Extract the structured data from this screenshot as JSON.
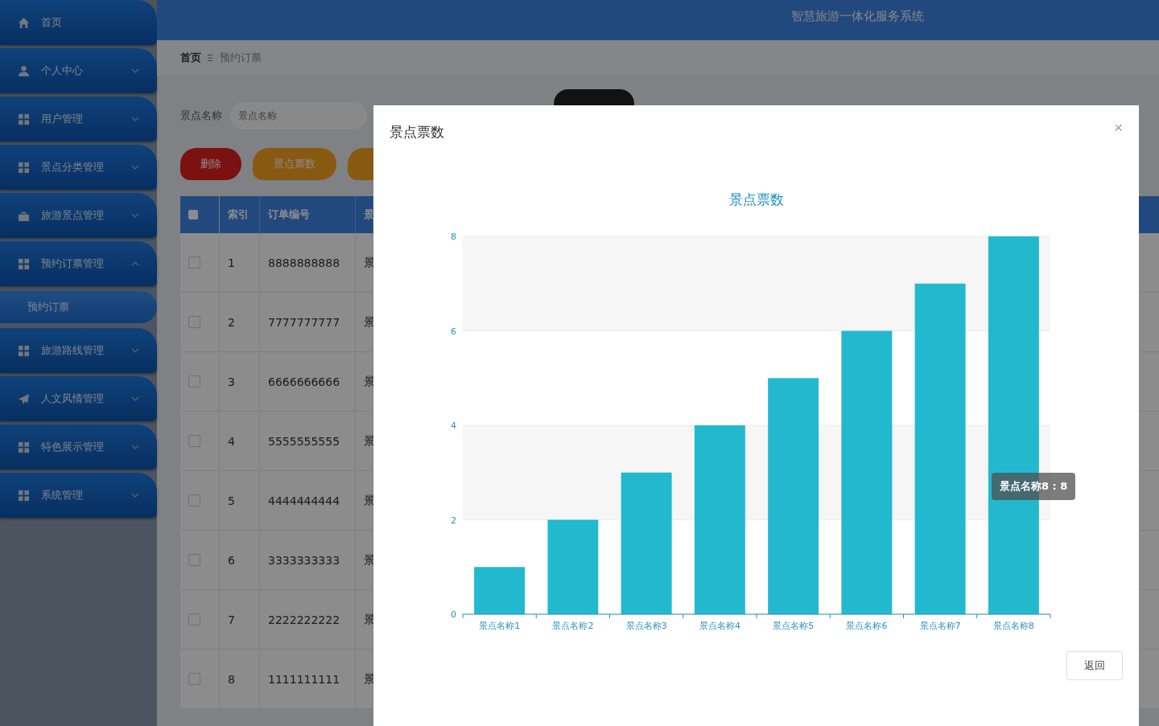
{
  "sidebar": {
    "items": [
      {
        "label": "首页",
        "kind": "home"
      },
      {
        "label": "个人中心",
        "kind": "user",
        "expanded": false
      },
      {
        "label": "用户管理",
        "kind": "grid",
        "expanded": false
      },
      {
        "label": "景点分类管理",
        "kind": "grid",
        "expanded": false
      },
      {
        "label": "旅游景点管理",
        "kind": "case",
        "expanded": false
      },
      {
        "label": "预约订票管理",
        "kind": "grid",
        "expanded": true,
        "children": [
          {
            "label": "预约订票",
            "selected": true
          }
        ]
      },
      {
        "label": "旅游路线管理",
        "kind": "grid",
        "expanded": false
      },
      {
        "label": "人文风情管理",
        "kind": "plane",
        "expanded": false
      },
      {
        "label": "特色展示管理",
        "kind": "grid",
        "expanded": false
      },
      {
        "label": "系统管理",
        "kind": "grid",
        "expanded": false
      }
    ]
  },
  "header": {
    "title": "智慧旅游一体化服务系统"
  },
  "breadcrumb": [
    "首页",
    "预约订票"
  ],
  "search": {
    "label": "景点名称",
    "placeholder": "景点名称"
  },
  "buttons": [
    {
      "label": "删除",
      "kind": "danger"
    },
    {
      "label": "景点票数",
      "kind": "warning"
    },
    {
      "kind": "warning"
    }
  ],
  "table": {
    "columns": [
      "索引",
      "订单编号",
      "景"
    ],
    "header_checked": false,
    "rows": [
      {
        "checked": false,
        "cells": [
          "1",
          "8888888888",
          "景"
        ]
      },
      {
        "checked": false,
        "cells": [
          "2",
          "7777777777",
          "景"
        ]
      },
      {
        "checked": false,
        "cells": [
          "3",
          "6666666666",
          "景"
        ]
      },
      {
        "checked": false,
        "cells": [
          "4",
          "5555555555",
          "景"
        ]
      },
      {
        "checked": false,
        "cells": [
          "5",
          "4444444444",
          "景"
        ]
      },
      {
        "checked": false,
        "cells": [
          "6",
          "3333333333",
          "景"
        ]
      },
      {
        "checked": false,
        "cells": [
          "7",
          "2222222222",
          "景"
        ]
      },
      {
        "checked": false,
        "cells": [
          "8",
          "1111111111",
          "景"
        ]
      }
    ]
  },
  "dialog": {
    "title": "景点票数",
    "close": "×",
    "footer_button": "返回",
    "chart_data": {
      "type": "bar",
      "title": "景点票数",
      "categories": [
        "景点名称1",
        "景点名称2",
        "景点名称3",
        "景点名称4",
        "景点名称5",
        "景点名称6",
        "景点名称7",
        "景点名称8"
      ],
      "values": [
        1,
        2,
        3,
        4,
        5,
        6,
        7,
        8
      ],
      "grid": true,
      "ylim": [
        0,
        8
      ],
      "yticks": [
        0,
        2,
        4,
        6,
        8
      ],
      "color": "#22b9ce"
    },
    "tooltip": "景点名称8 : 8"
  }
}
